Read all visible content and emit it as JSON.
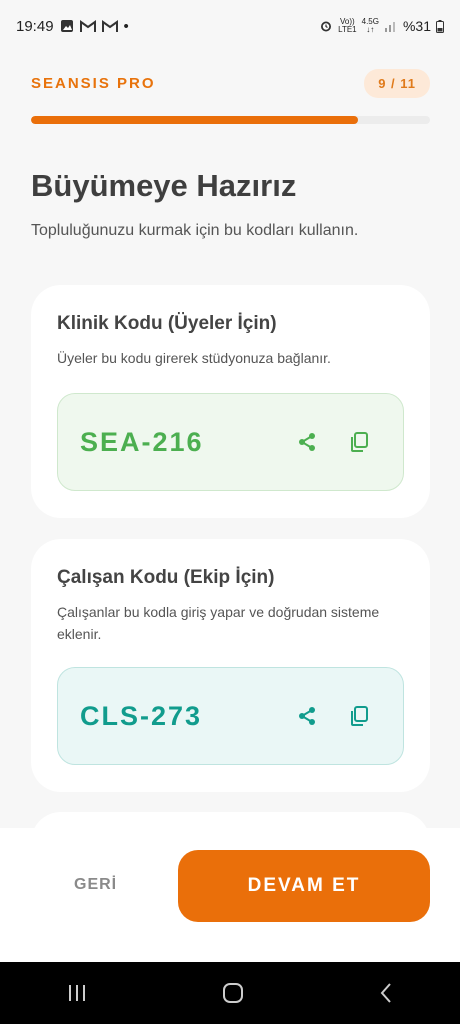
{
  "status_bar": {
    "time": "19:49",
    "dot": "•",
    "network_top": "Vo))",
    "network_bottom": "LTE1",
    "band_top": "4.5G",
    "band_bottom": "↓↑",
    "battery": "%31"
  },
  "header": {
    "brand": "SEANSIS PRO",
    "step": "9 / 11",
    "progress": 0.82
  },
  "main": {
    "title": "Büyümeye Hazırız",
    "subtitle": "Topluluğunuzu kurmak için bu kodları kullanın."
  },
  "cards": [
    {
      "title": "Klinik Kodu (Üyeler İçin)",
      "description": "Üyeler bu kodu girerek stüdyonuza bağlanır.",
      "code": "SEA-216",
      "color": "#4caf50"
    },
    {
      "title": "Çalışan Kodu (Ekip İçin)",
      "description": "Çalışanlar bu kodla giriş yapar ve doğrudan sisteme eklenir.",
      "code": "CLS-273",
      "color": "#119c8d"
    }
  ],
  "footer": {
    "back_label": "GERİ",
    "next_label": "DEVAM ET"
  },
  "icons": {
    "share": "share-icon",
    "copy": "copy-icon",
    "recents": "recents-icon",
    "home": "home-icon",
    "back": "back-icon"
  }
}
